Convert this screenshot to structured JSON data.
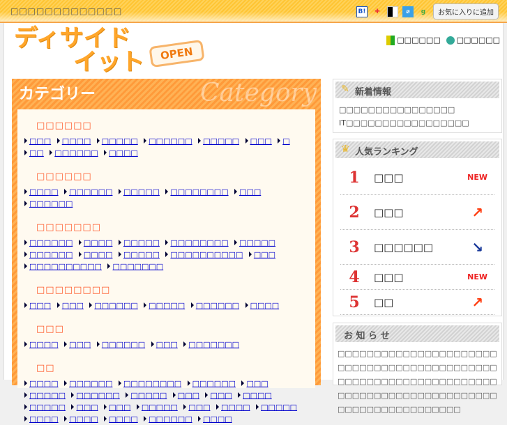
{
  "topbar": {
    "tagline": "□□□□□□□□□□□□□",
    "favorite": "お気に入りに追加"
  },
  "logo": {
    "line1": "ディサイド",
    "line2": "イット",
    "tag": "OPEN"
  },
  "header_links": [
    "□□□□□□",
    "□□□□□□"
  ],
  "category": {
    "title": "カテゴリー",
    "script": "Category",
    "sections": [
      {
        "title": "□□□□□□",
        "links": [
          "□□□",
          "□□□□",
          "□□□□□",
          "□□□□□□",
          "□□□□□",
          "□□□",
          "□",
          "□□",
          "□□□□□□",
          "□□□□"
        ]
      },
      {
        "title": "□□□□□□",
        "links": [
          "□□□□",
          "□□□□□□",
          "□□□□□",
          "□□□□□□□□",
          "□□□",
          "□□□□□□"
        ]
      },
      {
        "title": "□□□□□□□",
        "links": [
          "□□□□□□",
          "□□□□",
          "□□□□□",
          "□□□□□□□□",
          "□□□□□",
          "□□□□□□",
          "□□□□",
          "□□□□□",
          "□□□□□□□□□□",
          "□□□",
          "□□□□□□□□□□",
          "□□□□□□□"
        ]
      },
      {
        "title": "□□□□□□□□",
        "links": [
          "□□□",
          "□□□",
          "□□□□□□",
          "□□□□□",
          "□□□□□□",
          "□□□□"
        ]
      },
      {
        "title": "□□□",
        "links": [
          "□□□□",
          "□□□",
          "□□□□□□",
          "□□□",
          "□□□□□□□"
        ]
      },
      {
        "title": "□□",
        "links": [
          "□□□□",
          "□□□□□□",
          "□□□□□□□□",
          "□□□□□□",
          "□□□",
          "□□□□□",
          "□□□□□□",
          "□□□□□",
          "□□□",
          "□□□",
          "□□□□",
          "□□□□□",
          "□□□",
          "□□□",
          "□□□□□",
          "□□□",
          "□□□□",
          "□□□□□",
          "□□□□",
          "□□□□",
          "□□□□",
          "□□□□□□",
          "□□□□"
        ]
      }
    ]
  },
  "news": {
    "title": "新着情報",
    "items": [
      "□□□□□□□□□□□□□□□□",
      "IT□□□□□□□□□□□□□□□□□"
    ]
  },
  "ranking": {
    "title": "人気ランキング",
    "items": [
      {
        "rank": "1",
        "name": "□□□",
        "trend": "NEW"
      },
      {
        "rank": "2",
        "name": "□□□",
        "trend": "up"
      },
      {
        "rank": "3",
        "name": "□□□□□□",
        "trend": "down"
      },
      {
        "rank": "4",
        "name": "□□□",
        "trend": "NEW"
      },
      {
        "rank": "5",
        "name": "□□",
        "trend": "up"
      }
    ]
  },
  "notice": {
    "title": "お 知 ら せ",
    "text": "□□□□□□□□□□□□□□□□□□□□□□□□□□□□□□□□□□□□□□□□□□□□□□□□□□□□□□□□□□□□□□□□□□□□□□□□□□□□□□□□□□□□□□□□□□□□□□□□□□□□□□□□□"
  }
}
